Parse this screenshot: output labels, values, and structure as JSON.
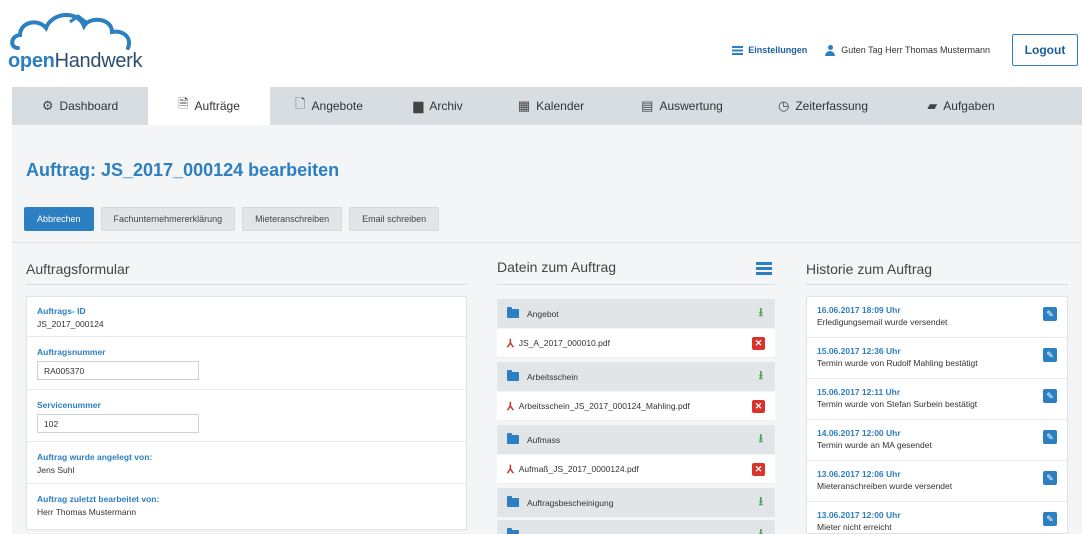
{
  "brand": {
    "open": "open",
    "rest": "Handwerk"
  },
  "topnav": {
    "settings": "Einstellungen",
    "greeting": "Guten Tag Herr Thomas Mustermann",
    "logout": "Logout"
  },
  "tabs": [
    {
      "label": "Dashboard",
      "icon": "dashboard-icon",
      "glyph": "⚙"
    },
    {
      "label": "Aufträge",
      "icon": "document-icon",
      "glyph": "🗎"
    },
    {
      "label": "Angebote",
      "icon": "file-icon",
      "glyph": "🗋"
    },
    {
      "label": "Archiv",
      "icon": "archive-icon",
      "glyph": "▆"
    },
    {
      "label": "Kalender",
      "icon": "calendar-icon",
      "glyph": "▦"
    },
    {
      "label": "Auswertung",
      "icon": "table-icon",
      "glyph": "▤"
    },
    {
      "label": "Zeiterfassung",
      "icon": "clock-icon",
      "glyph": "◷"
    },
    {
      "label": "Aufgaben",
      "icon": "book-icon",
      "glyph": "▰"
    }
  ],
  "page": {
    "title": "Auftrag: JS_2017_000124 bearbeiten"
  },
  "actions": {
    "cancel": "Abbrechen",
    "declaration": "Fachunternehmererklärung",
    "tenant_letter": "Mieteranschreiben",
    "email": "Email schreiben"
  },
  "form": {
    "title": "Auftragsformular",
    "id_label": "Auftrags- ID",
    "id_value": "JS_2017_000124",
    "number_label": "Auftragsnummer",
    "number_value": "RA005370",
    "service_label": "Servicenummer",
    "service_value": "102",
    "created_label": "Auftrag wurde angelegt von:",
    "created_value": "Jens Suhl",
    "edited_label": "Auftrag zuletzt bearbeitet von:",
    "edited_value": "Herr Thomas Mustermann"
  },
  "files": {
    "title": "Datein zum Auftrag",
    "rows": [
      {
        "type": "folder",
        "label": "Angebot"
      },
      {
        "type": "file",
        "label": "JS_A_2017_000010.pdf"
      },
      {
        "type": "folder",
        "label": "Arbeitsschein"
      },
      {
        "type": "file",
        "label": "Arbeitsschein_JS_2017_000124_Mahling.pdf"
      },
      {
        "type": "folder",
        "label": "Aufmass"
      },
      {
        "type": "file",
        "label": "Aufmaß_JS_2017_0000124.pdf"
      },
      {
        "type": "folder",
        "label": "Auftragsbescheinigung"
      },
      {
        "type": "folder",
        "label": ""
      }
    ]
  },
  "history": {
    "title": "Historie zum Auftrag",
    "items": [
      {
        "date": "16.06.2017 18:09 Uhr",
        "text": "Erledigungsemail wurde versendet"
      },
      {
        "date": "15.06.2017 12:36 Uhr",
        "text": "Termin wurde von Rudolf Mahling bestätigt"
      },
      {
        "date": "15.06.2017 12:11 Uhr",
        "text": "Termin wurde von Stefan Surbein bestätigt"
      },
      {
        "date": "14.06.2017 12:00 Uhr",
        "text": "Termin wurde an MA gesendet"
      },
      {
        "date": "13.06.2017 12:06 Uhr",
        "text": "Mieteranschreiben wurde versendet"
      },
      {
        "date": "13.06.2017 12:00 Uhr",
        "text": "Mieter nicht erreicht"
      }
    ]
  }
}
